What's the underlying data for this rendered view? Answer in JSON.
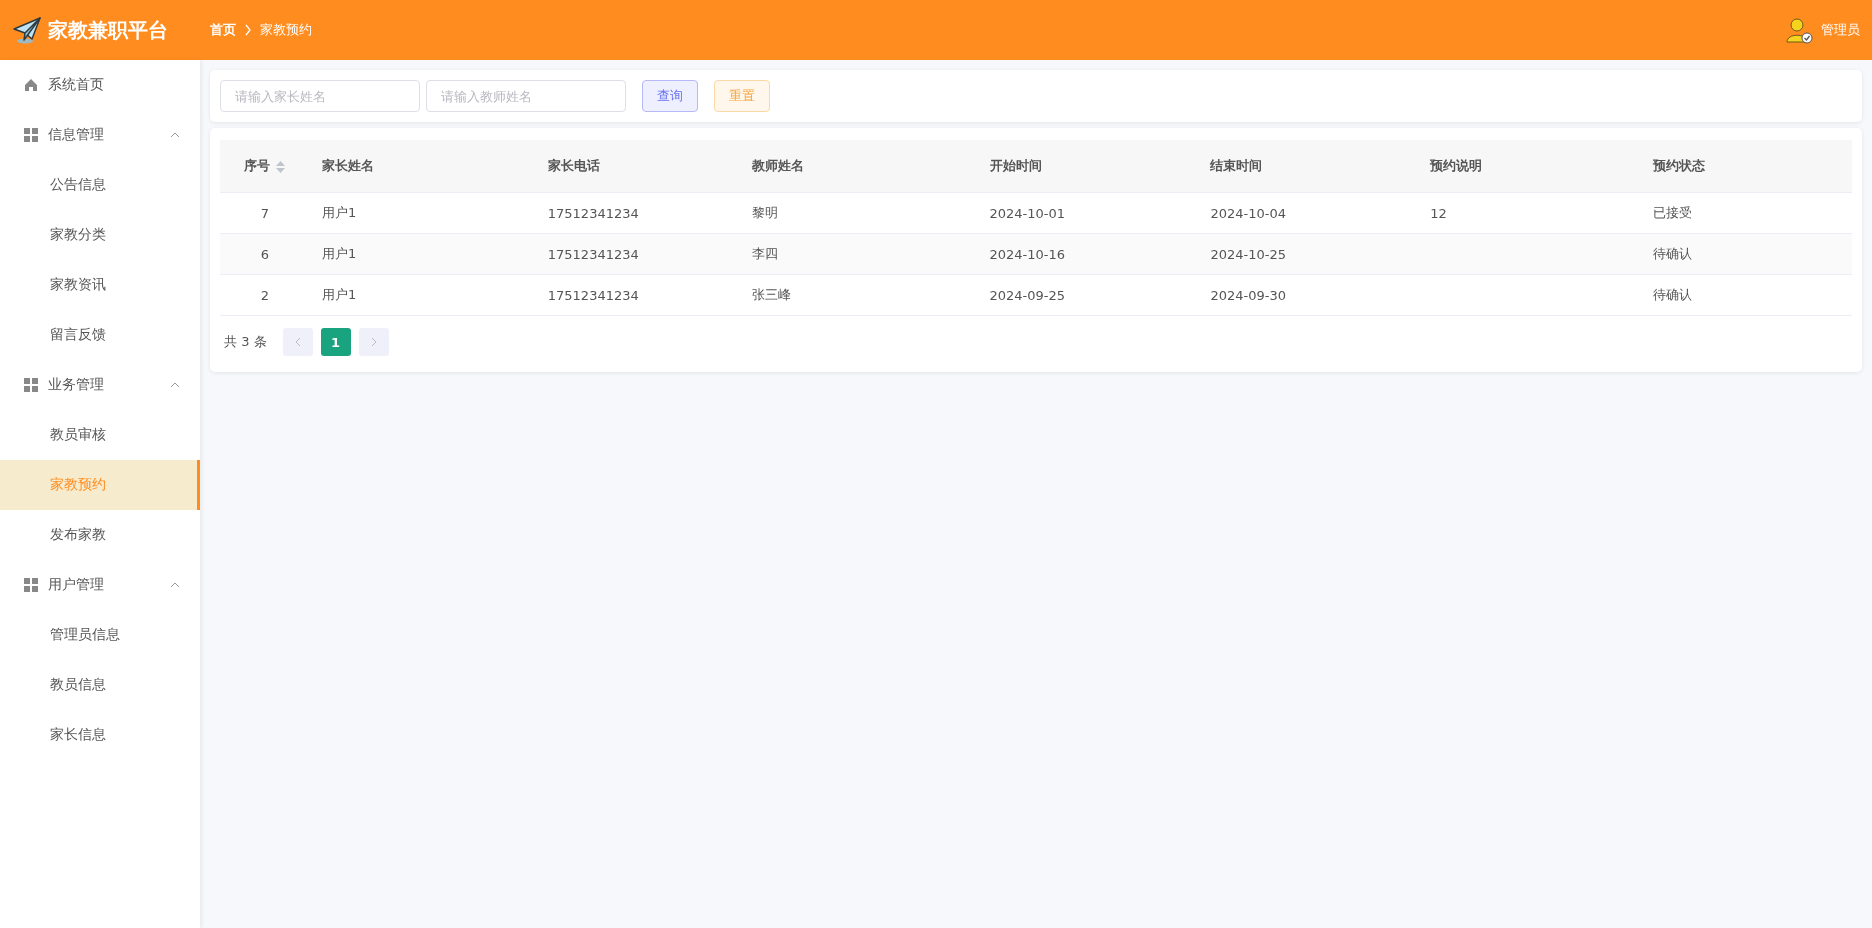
{
  "header": {
    "title": "家教兼职平台",
    "breadcrumb": [
      "首页",
      "家教预约"
    ],
    "user": "管理员"
  },
  "sidebar": {
    "items": [
      {
        "kind": "link",
        "label": "系统首页",
        "selected": false
      },
      {
        "kind": "group",
        "label": "信息管理",
        "expanded": true,
        "children": [
          {
            "label": "公告信息",
            "selected": false
          },
          {
            "label": "家教分类",
            "selected": false
          },
          {
            "label": "家教资讯",
            "selected": false
          },
          {
            "label": "留言反馈",
            "selected": false
          }
        ]
      },
      {
        "kind": "group",
        "label": "业务管理",
        "expanded": true,
        "children": [
          {
            "label": "教员审核",
            "selected": false
          },
          {
            "label": "家教预约",
            "selected": true
          },
          {
            "label": "发布家教",
            "selected": false
          }
        ]
      },
      {
        "kind": "group",
        "label": "用户管理",
        "expanded": true,
        "children": [
          {
            "label": "管理员信息",
            "selected": false
          },
          {
            "label": "教员信息",
            "selected": false
          },
          {
            "label": "家长信息",
            "selected": false
          }
        ]
      }
    ]
  },
  "search": {
    "fields": [
      {
        "placeholder": "请输入家长姓名"
      },
      {
        "placeholder": "请输入教师姓名"
      }
    ],
    "buttons": [
      {
        "label": "查询",
        "kind": "primary"
      },
      {
        "label": "重置",
        "kind": "warning"
      }
    ]
  },
  "table": {
    "columns": [
      "序号",
      "家长姓名",
      "家长电话",
      "教师姓名",
      "开始时间",
      "结束时间",
      "预约说明",
      "预约状态"
    ],
    "rows": [
      [
        "7",
        "用户1",
        "17512341234",
        "黎明",
        "2024-10-01",
        "2024-10-04",
        "12",
        "已接受"
      ],
      [
        "6",
        "用户1",
        "17512341234",
        "李四",
        "2024-10-16",
        "2024-10-25",
        "",
        "待确认"
      ],
      [
        "2",
        "用户1",
        "17512341234",
        "张三峰",
        "2024-09-25",
        "2024-09-30",
        "",
        "待确认"
      ]
    ]
  },
  "pagination": {
    "total": "共 3 条",
    "pages": [
      {
        "label": "1",
        "selected": true
      }
    ]
  }
}
